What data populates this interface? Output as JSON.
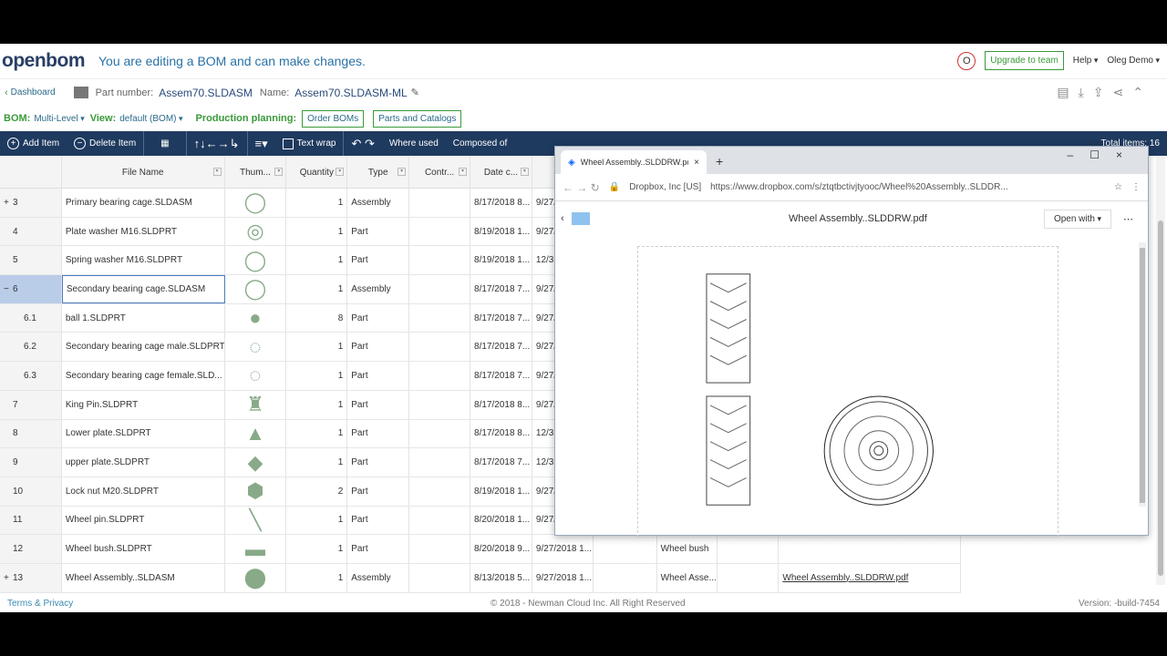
{
  "header": {
    "logo": "openbom",
    "message": "You are editing a BOM and can make changes.",
    "user_initial": "O",
    "upgrade_label": "Upgrade to team",
    "help_label": "Help",
    "user_label": "Oleg Demo"
  },
  "bar": {
    "dashboard": "Dashboard",
    "part_number_label": "Part number:",
    "part_number": "Assem70.SLDASM",
    "name_label": "Name:",
    "name": "Assem70.SLDASM-ML"
  },
  "bom": {
    "bom_label": "BOM:",
    "bom_value": "Multi-Level",
    "view_label": "View:",
    "view_value": "default (BOM)",
    "planning_label": "Production planning:",
    "order_boms": "Order BOMs",
    "parts_catalogs": "Parts and Catalogs"
  },
  "toolbar": {
    "add_item": "Add Item",
    "delete_item": "Delete Item",
    "text_wrap": "Text wrap",
    "where_used": "Where used",
    "composed_of": "Composed of",
    "property_order": "Property order",
    "filter": "Filter",
    "info_panel": "Info panel",
    "total_items": "Total items: 16"
  },
  "columns": [
    "",
    "File Name",
    "Thum...",
    "Quantity",
    "Type",
    "Contr...",
    "Date c...",
    "Da",
    "",
    "",
    "",
    ""
  ],
  "rows": [
    {
      "num": "3",
      "exp": "+",
      "name": "Primary bearing cage.SLDASM",
      "icon": "◯",
      "qty": "1",
      "type": "Assembly",
      "date": "8/17/2018 8...",
      "d2": "9/27/",
      "c9": "",
      "c10": "",
      "c11": ""
    },
    {
      "num": "4",
      "exp": "",
      "name": "Plate washer M16.SLDPRT",
      "icon": "◎",
      "qty": "1",
      "type": "Part",
      "date": "8/19/2018 1...",
      "d2": "9/27/",
      "c9": "",
      "c10": "",
      "c11": ""
    },
    {
      "num": "5",
      "exp": "",
      "name": "Spring washer M16.SLDPRT",
      "icon": "◯",
      "qty": "1",
      "type": "Part",
      "date": "8/19/2018 1...",
      "d2": "12/3",
      "c9": "",
      "c10": "",
      "c11": ""
    },
    {
      "num": "6",
      "exp": "−",
      "name": "Secondary bearing cage.SLDASM",
      "icon": "◯",
      "qty": "1",
      "type": "Assembly",
      "date": "8/17/2018 7...",
      "d2": "9/27/",
      "c9": "",
      "c10": "",
      "c11": ""
    },
    {
      "num": "6.1",
      "exp": "",
      "name": "ball 1.SLDPRT",
      "icon": "●",
      "qty": "8",
      "type": "Part",
      "date": "8/17/2018 7...",
      "d2": "9/27/",
      "c9": "",
      "c10": "",
      "c11": ""
    },
    {
      "num": "6.2",
      "exp": "",
      "name": "Secondary bearing cage male.SLDPRT",
      "icon": "◌",
      "qty": "1",
      "type": "Part",
      "date": "8/17/2018 7...",
      "d2": "9/27/",
      "c9": "",
      "c10": "",
      "c11": ""
    },
    {
      "num": "6.3",
      "exp": "",
      "name": "Secondary bearing cage female.SLD...",
      "icon": "◌",
      "qty": "1",
      "type": "Part",
      "date": "8/17/2018 7...",
      "d2": "9/27/",
      "c9": "",
      "c10": "",
      "c11": ""
    },
    {
      "num": "7",
      "exp": "",
      "name": "King Pin.SLDPRT",
      "icon": "♜",
      "qty": "1",
      "type": "Part",
      "date": "8/17/2018 8...",
      "d2": "9/27/",
      "c9": "",
      "c10": "",
      "c11": ""
    },
    {
      "num": "8",
      "exp": "",
      "name": "Lower plate.SLDPRT",
      "icon": "▲",
      "qty": "1",
      "type": "Part",
      "date": "8/17/2018 8...",
      "d2": "12/3",
      "c9": "",
      "c10": "",
      "c11": ""
    },
    {
      "num": "9",
      "exp": "",
      "name": "upper plate.SLDPRT",
      "icon": "◆",
      "qty": "1",
      "type": "Part",
      "date": "8/17/2018 7...",
      "d2": "12/3",
      "c9": "",
      "c10": "",
      "c11": ""
    },
    {
      "num": "10",
      "exp": "",
      "name": "Lock nut M20.SLDPRT",
      "icon": "⬢",
      "qty": "2",
      "type": "Part",
      "date": "8/19/2018 1...",
      "d2": "9/27/",
      "c9": "",
      "c10": "",
      "c11": ""
    },
    {
      "num": "11",
      "exp": "",
      "name": "Wheel pin.SLDPRT",
      "icon": "╲",
      "qty": "1",
      "type": "Part",
      "date": "8/20/2018 1...",
      "d2": "9/27/",
      "c9": "",
      "c10": "",
      "c11": ""
    },
    {
      "num": "12",
      "exp": "",
      "name": "Wheel bush.SLDPRT",
      "icon": "▬",
      "qty": "1",
      "type": "Part",
      "date": "8/20/2018 9...",
      "d2": "9/27/2018 1...",
      "c9": "Wheel bush",
      "c10": "",
      "c11": ""
    },
    {
      "num": "13",
      "exp": "+",
      "name": "Wheel Assembly..SLDASM",
      "icon": "⬤",
      "qty": "1",
      "type": "Assembly",
      "date": "8/13/2018 5...",
      "d2": "9/27/2018 1...",
      "c9": "Wheel Asse...",
      "c10": "",
      "c11": "Wheel Assembly..SLDDRW.pdf"
    }
  ],
  "footer": {
    "terms": "Terms & Privacy",
    "copyright": "© 2018 - Newman Cloud Inc. All Right Reserved",
    "version": "Version: -build-7454"
  },
  "browser": {
    "tab_title": "Wheel Assembly..SLDDRW.pdf",
    "site": "Dropbox, Inc [US]",
    "url": "https://www.dropbox.com/s/ztqtbctivjtyooc/Wheel%20Assembly..SLDDR...",
    "file_title": "Wheel Assembly..SLDDRW.pdf",
    "open_with": "Open with"
  }
}
